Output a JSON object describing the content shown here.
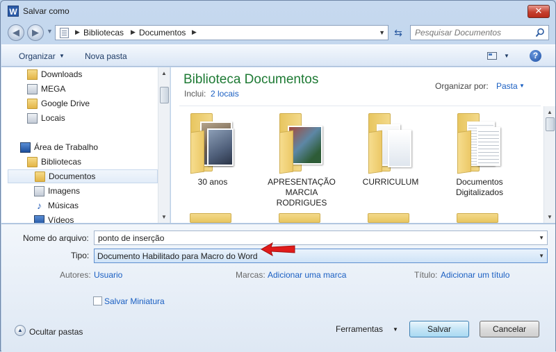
{
  "window": {
    "title": "Salvar como",
    "app_icon": "W",
    "close_label": "✕"
  },
  "address": {
    "crumbs": [
      "Bibliotecas",
      "Documentos"
    ],
    "search_placeholder": "Pesquisar Documentos"
  },
  "toolbar": {
    "organize_label": "Organizar",
    "new_folder_label": "Nova pasta",
    "help_label": "?"
  },
  "nav": {
    "items": [
      {
        "label": "Downloads",
        "icon": "downloads-folder-icon"
      },
      {
        "label": "MEGA",
        "icon": "drive-icon"
      },
      {
        "label": "Google Drive",
        "icon": "folder-icon"
      },
      {
        "label": "Locais",
        "icon": "places-icon"
      },
      {
        "label": "Área de Trabalho",
        "icon": "desktop-icon"
      },
      {
        "label": "Bibliotecas",
        "icon": "library-icon"
      },
      {
        "label": "Documentos",
        "icon": "documents-icon",
        "selected": true
      },
      {
        "label": "Imagens",
        "icon": "pictures-icon"
      },
      {
        "label": "Músicas",
        "icon": "music-icon"
      },
      {
        "label": "Vídeos",
        "icon": "videos-icon"
      }
    ]
  },
  "library": {
    "title": "Biblioteca Documentos",
    "include_label": "Inclui:",
    "include_link": "2 locais",
    "arrange_label": "Organizar por:",
    "arrange_value": "Pasta",
    "folders": [
      {
        "label": "30 anos"
      },
      {
        "label": "APRESENTAÇÃO MARCIA RODRIGUES"
      },
      {
        "label": "CURRICULUM"
      },
      {
        "label": "Documentos Digitalizados"
      }
    ]
  },
  "form": {
    "filename_label": "Nome do arquivo:",
    "filename_value": "ponto de inserção",
    "type_label": "Tipo:",
    "type_value": "Documento Habilitado para Macro do Word",
    "authors_label": "Autores:",
    "authors_value": "Usuario",
    "tags_label": "Marcas:",
    "tags_value": "Adicionar uma marca",
    "title_label": "Título:",
    "title_value": "Adicionar um título",
    "thumbnail_label": "Salvar Miniatura",
    "hide_folders_label": "Ocultar pastas",
    "tools_label": "Ferramentas",
    "save_label": "Salvar",
    "cancel_label": "Cancelar"
  },
  "colors": {
    "library_title": "#1e7a34",
    "link": "#1a5fc2",
    "annotation_arrow": "#e01b1b"
  }
}
